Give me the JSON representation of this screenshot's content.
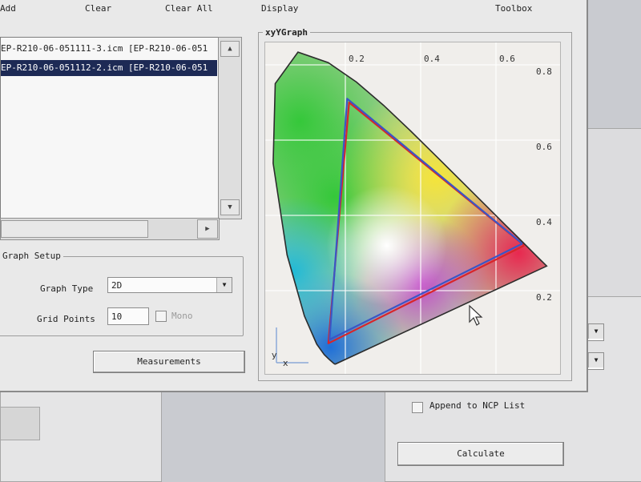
{
  "menu": {
    "add": "Add",
    "clear": "Clear",
    "clear_all": "Clear All",
    "display": "Display",
    "toolbox": "Toolbox"
  },
  "file_list": {
    "items": [
      {
        "label": "EP-R210-06-051111-3.icm [EP-R210-06-051"
      },
      {
        "label": "EP-R210-06-051112-2.icm [EP-R210-06-051"
      }
    ],
    "selected_index": 1
  },
  "graph_setup": {
    "title": "Graph Setup",
    "graph_type_label": "Graph Type",
    "graph_type_value": "2D",
    "grid_points_label": "Grid Points",
    "grid_points_value": "10",
    "mono_label": "Mono"
  },
  "measurements_button": "Measurements",
  "graph": {
    "title": "xyYGraph",
    "x_ticks": [
      "0.2",
      "0.4",
      "0.6"
    ],
    "y_ticks": [
      "0.8",
      "0.6",
      "0.4",
      "0.2"
    ],
    "x_axis_symbol": "x",
    "y_axis_symbol": "y"
  },
  "right_panel": {
    "append_label": "Append to NCP List",
    "calculate_button": "Calculate"
  },
  "chart_data": {
    "type": "scatter",
    "title": "xyYGraph",
    "xlabel": "x",
    "ylabel": "y",
    "xlim": [
      0,
      0.75
    ],
    "ylim": [
      0,
      0.85
    ],
    "x_ticks": [
      0.2,
      0.4,
      0.6
    ],
    "y_ticks": [
      0.2,
      0.4,
      0.6,
      0.8
    ],
    "grid": true,
    "spectral_locus": {
      "x": [
        0.1741,
        0.1738,
        0.1736,
        0.173,
        0.1714,
        0.1689,
        0.1644,
        0.1566,
        0.144,
        0.1241,
        0.0913,
        0.0454,
        0.0082,
        0.0139,
        0.0743,
        0.1547,
        0.2296,
        0.3016,
        0.3731,
        0.4441,
        0.5125,
        0.5752,
        0.627,
        0.6658,
        0.6915,
        0.7079,
        0.719,
        0.726,
        0.7347
      ],
      "y": [
        0.005,
        0.0049,
        0.0049,
        0.0048,
        0.0051,
        0.0069,
        0.0109,
        0.0177,
        0.0297,
        0.0578,
        0.1327,
        0.295,
        0.5384,
        0.7502,
        0.8338,
        0.8059,
        0.7543,
        0.6923,
        0.6245,
        0.5547,
        0.4866,
        0.4242,
        0.3725,
        0.334,
        0.3083,
        0.292,
        0.2809,
        0.274,
        0.2653
      ]
    },
    "series": [
      {
        "color": "#d7262b",
        "x": [
          0.675,
          0.21,
          0.155,
          0.675
        ],
        "y": [
          0.32,
          0.7,
          0.06,
          0.32
        ]
      },
      {
        "color": "#3a56c6",
        "x": [
          0.67,
          0.205,
          0.158,
          0.67
        ],
        "y": [
          0.325,
          0.71,
          0.07,
          0.325
        ]
      }
    ]
  },
  "colors": {
    "selection_bg": "#1d2a55",
    "red_gamut": "#d7262b",
    "blue_gamut": "#3a56c6"
  }
}
